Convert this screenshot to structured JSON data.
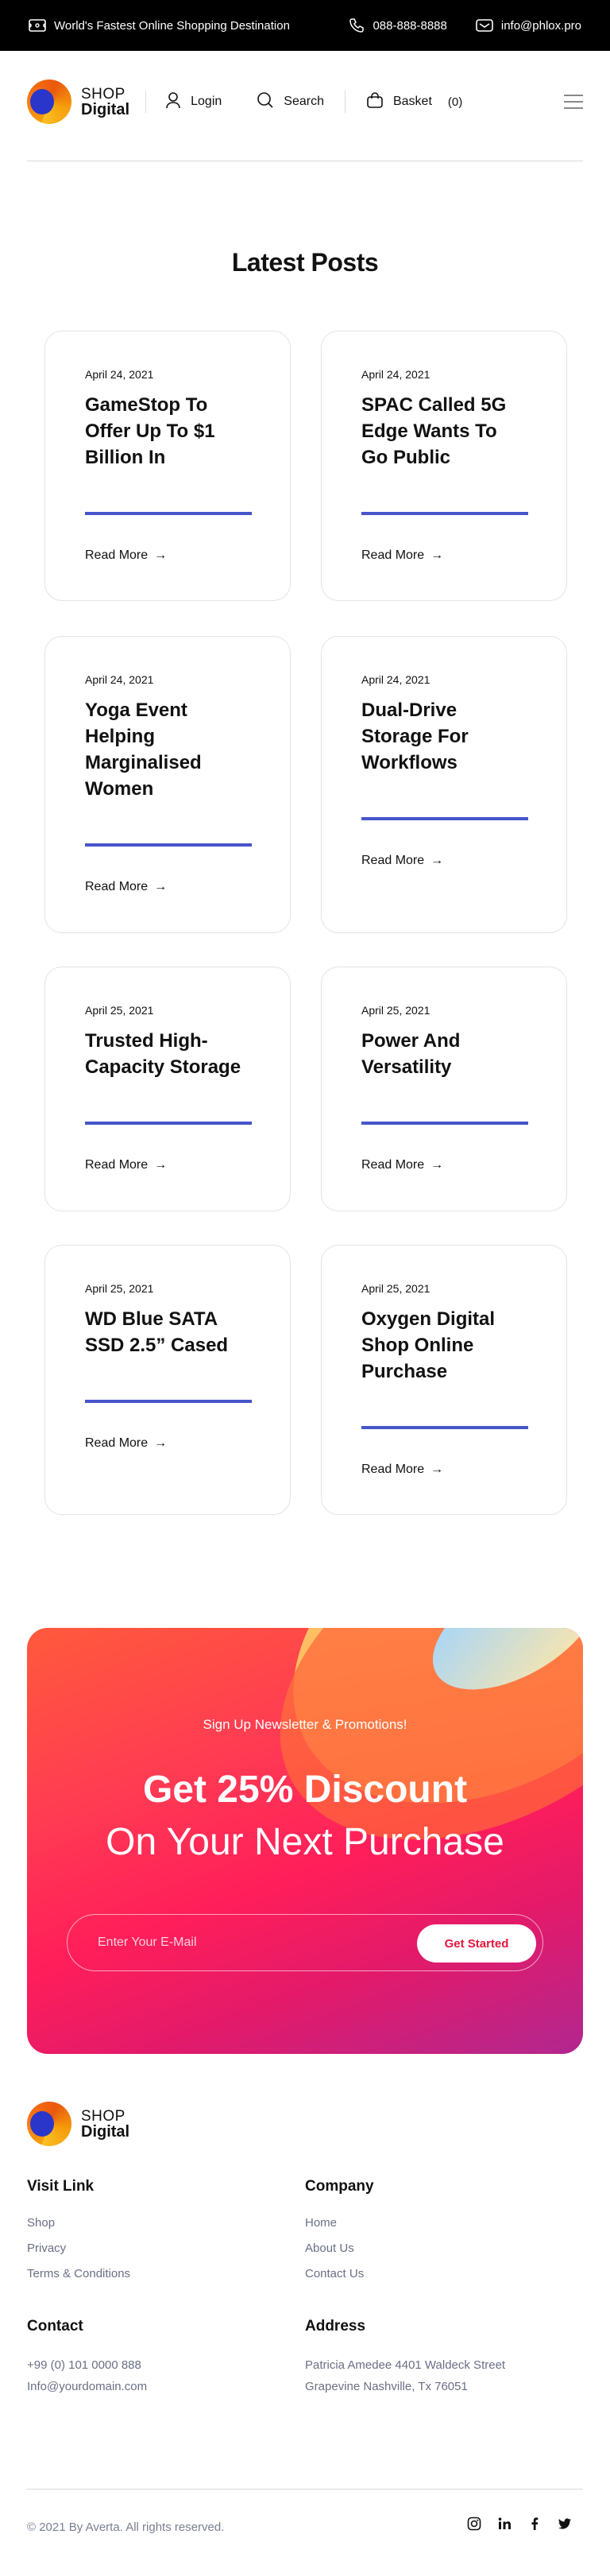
{
  "topbar": {
    "tagline": "World's Fastest Online Shopping Destination",
    "phone": "088-888-8888",
    "email": "info@phlox.pro"
  },
  "header": {
    "logo_line1": "SHOP",
    "logo_line2": "Digital",
    "login_label": "Login",
    "search_label": "Search",
    "basket_label": "Basket",
    "basket_count": "(0)"
  },
  "posts_section": {
    "title": "Latest Posts",
    "read_more_label": "Read More",
    "arrow": "→",
    "posts": [
      {
        "date": "April 24, 2021",
        "title": "GameStop To Offer Up To $1 Billion In"
      },
      {
        "date": "April 24, 2021",
        "title": "SPAC Called 5G Edge Wants To Go Public"
      },
      {
        "date": "April 24, 2021",
        "title": "Yoga Event Helping Marginalised Women"
      },
      {
        "date": "April 24, 2021",
        "title": "Dual-Drive Storage For Workflows"
      },
      {
        "date": "April 25, 2021",
        "title": "Trusted High-Capacity Storage"
      },
      {
        "date": "April 25, 2021",
        "title": "Power And Versatility"
      },
      {
        "date": "April 25, 2021",
        "title": "WD Blue SATA SSD 2.5” Cased"
      },
      {
        "date": "April 25, 2021",
        "title": "Oxygen Digital Shop Online Purchase"
      }
    ]
  },
  "newsletter": {
    "kicker": "Sign Up Newsletter & Promotions!",
    "headline": "Get 25% Discount",
    "subheadline": "On Your Next Purchase",
    "email_placeholder": "Enter Your E-Mail",
    "email_value": "",
    "cta_label": "Get Started"
  },
  "footer": {
    "logo_line1": "SHOP",
    "logo_line2": "Digital",
    "visit_title": "Visit Link",
    "visit_links": [
      "Shop",
      "Privacy",
      "Terms & Conditions"
    ],
    "company_title": "Company",
    "company_links": [
      "Home",
      "About Us",
      "Contact Us"
    ],
    "contact_title": "Contact",
    "contact_phone": "+99 (0) 101 0000 888",
    "contact_email": "Info@yourdomain.com",
    "address_title": "Address",
    "address_line1": "Patricia Amedee 4401 Waldeck Street",
    "address_line2": "Grapevine Nashville, Tx 76051",
    "copyright": "© 2021 By Averta. All rights reserved.",
    "socials": [
      "instagram-icon",
      "linkedin-icon",
      "facebook-icon",
      "twitter-icon"
    ]
  },
  "colors": {
    "accent_bar": "#4655c9",
    "cta_text": "#e6153d",
    "topbar_bg": "#000000"
  }
}
